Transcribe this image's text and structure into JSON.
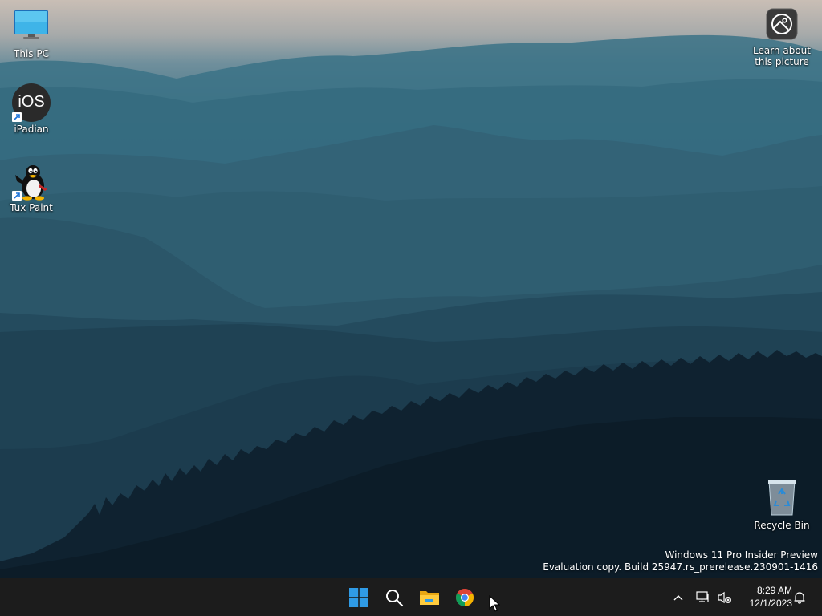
{
  "desktop_icons": {
    "this_pc": "This PC",
    "ipadian": "iPadian",
    "ipadian_glyph_text": "iOS",
    "tux_paint": "Tux Paint",
    "learn_picture": [
      "Learn about",
      "this picture"
    ],
    "recycle_bin": "Recycle Bin"
  },
  "watermark": {
    "line1": "Windows 11 Pro Insider Preview",
    "line2": "Evaluation copy. Build 25947.rs_prerelease.230901-1416"
  },
  "taskbar": {
    "apps": [
      {
        "name": "start",
        "icon": "windows-start-icon"
      },
      {
        "name": "search",
        "icon": "search-icon"
      },
      {
        "name": "file-explorer",
        "icon": "folder-icon"
      },
      {
        "name": "chrome",
        "icon": "chrome-icon"
      }
    ],
    "tray_icons": [
      "chevron-up-icon",
      "network-icon",
      "volume-muted-icon",
      "notification-bell-icon"
    ],
    "clock": {
      "time": "8:29 AM",
      "date": "12/1/2023"
    }
  },
  "colors": {
    "taskbar_bg": "#1c1c1c",
    "windows_blue": "#2f9be6",
    "sky_top": "#c9beb5"
  }
}
